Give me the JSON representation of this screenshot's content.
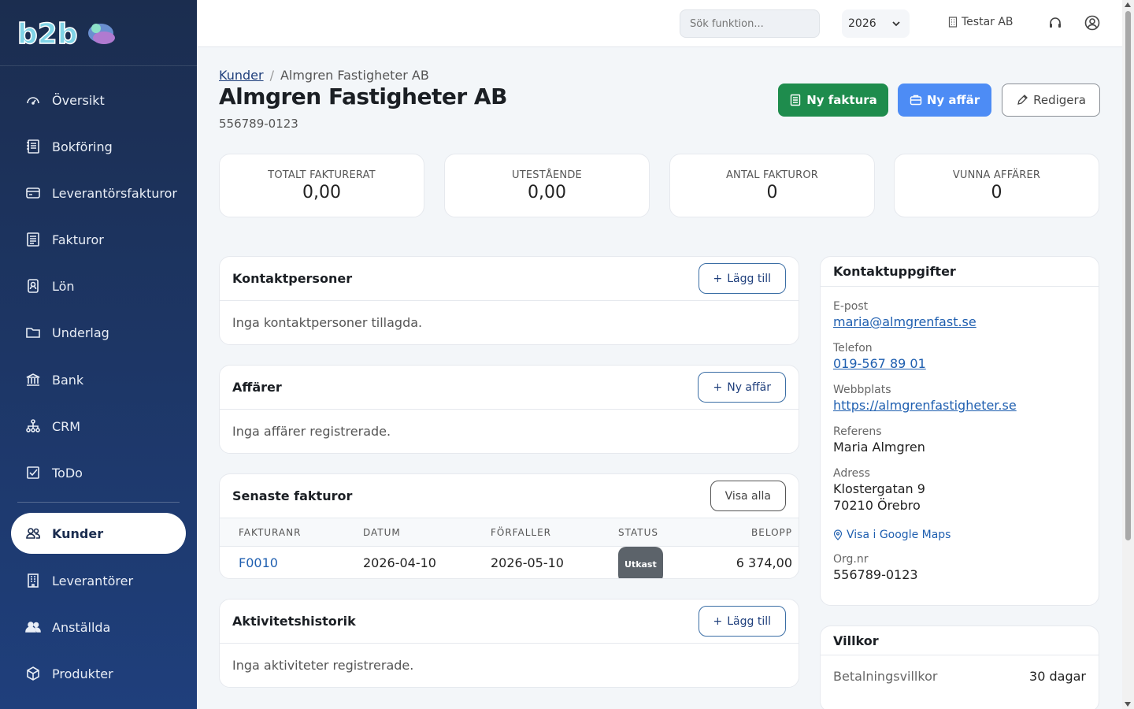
{
  "sidebar": {
    "items": [
      {
        "label": "Översikt",
        "icon": "dashboard-icon"
      },
      {
        "label": "Bokföring",
        "icon": "ledger-icon"
      },
      {
        "label": "Leverantörsfakturor",
        "icon": "credit-card-icon"
      },
      {
        "label": "Fakturor",
        "icon": "invoice-icon"
      },
      {
        "label": "Lön",
        "icon": "salary-icon"
      },
      {
        "label": "Underlag",
        "icon": "folder-icon"
      },
      {
        "label": "Bank",
        "icon": "bank-icon"
      },
      {
        "label": "CRM",
        "icon": "network-icon"
      },
      {
        "label": "ToDo",
        "icon": "checkbox-icon"
      },
      {
        "label": "Kunder",
        "icon": "customers-icon",
        "active": true
      },
      {
        "label": "Leverantörer",
        "icon": "building-icon"
      },
      {
        "label": "Anställda",
        "icon": "employees-icon"
      },
      {
        "label": "Produkter",
        "icon": "box-icon"
      }
    ]
  },
  "topbar": {
    "search_placeholder": "Sök funktion...",
    "year": "2026",
    "company": "Testar AB"
  },
  "header": {
    "breadcrumb_parent": "Kunder",
    "breadcrumb_sep": "/",
    "breadcrumb_current": "Almgren Fastigheter AB",
    "title": "Almgren Fastigheter AB",
    "org_nr": "556789-0123",
    "btn_new_invoice": "Ny faktura",
    "btn_new_deal": "Ny affär",
    "btn_edit": "Redigera"
  },
  "stats": [
    {
      "label": "TOTALT FAKTURERAT",
      "value": "0,00"
    },
    {
      "label": "UTESTÅENDE",
      "value": "0,00"
    },
    {
      "label": "ANTAL FAKTUROR",
      "value": "0"
    },
    {
      "label": "VUNNA AFFÄRER",
      "value": "0"
    }
  ],
  "contacts_card": {
    "title": "Kontaktpersoner",
    "button": "Lägg till",
    "empty": "Inga kontaktpersoner tillagda."
  },
  "deals_card": {
    "title": "Affärer",
    "button": "Ny affär",
    "empty": "Inga affärer registrerade."
  },
  "invoices_card": {
    "title": "Senaste fakturor",
    "button": "Visa alla",
    "columns": [
      "FAKTURANR",
      "DATUM",
      "FÖRFALLER",
      "STATUS",
      "BELOPP"
    ],
    "rows": [
      {
        "nr": "F0010",
        "date": "2026-04-10",
        "due": "2026-05-10",
        "status": "Utkast",
        "amount": "6 374,00"
      }
    ]
  },
  "activity_card": {
    "title": "Aktivitetshistorik",
    "button": "Lägg till",
    "empty": "Inga aktiviteter registrerade."
  },
  "contact_details": {
    "title": "Kontaktuppgifter",
    "email_label": "E-post",
    "email": "maria@almgrenfast.se",
    "phone_label": "Telefon",
    "phone": "019-567 89 01",
    "web_label": "Webbplats",
    "web": "https://almgrenfastigheter.se",
    "ref_label": "Referens",
    "ref": "Maria Almgren",
    "addr_label": "Adress",
    "addr_line1": "Klostergatan 9",
    "addr_line2": "70210 Örebro",
    "maps_link": "Visa i Google Maps",
    "org_label": "Org.nr",
    "org": "556789-0123"
  },
  "terms_card": {
    "title": "Villkor",
    "payment_label": "Betalningsvillkor",
    "payment_value": "30 dagar"
  },
  "colors": {
    "sidebar_top": "#1b2d4f",
    "sidebar_bottom": "#1f3f7c",
    "green": "#1e8c4d",
    "blue": "#4d8cf5",
    "link": "#1f5fb0"
  }
}
